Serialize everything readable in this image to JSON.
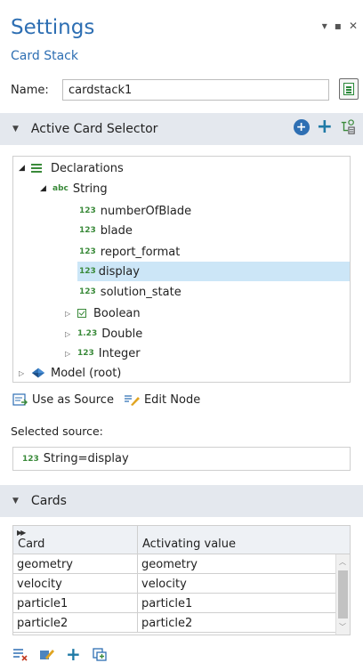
{
  "header": {
    "title": "Settings",
    "subtitle": "Card Stack",
    "window_controls": [
      "▾",
      "▪",
      "✕"
    ]
  },
  "name_field": {
    "label": "Name:",
    "value": "cardstack1"
  },
  "selector_section": {
    "title": "Active Card Selector"
  },
  "tree": {
    "nodes": [
      {
        "label": "Declarations",
        "icon": "list-icon",
        "expanded": true
      },
      {
        "label": "String",
        "icon": "abc-icon",
        "badge": "abc",
        "expanded": true
      },
      {
        "label": "numberOfBlade",
        "badge": "123"
      },
      {
        "label": "blade",
        "badge": "123"
      },
      {
        "label": "report_format",
        "badge": "123"
      },
      {
        "label": "display",
        "badge": "123",
        "selected": true
      },
      {
        "label": "solution_state",
        "badge": "123"
      },
      {
        "label": "Boolean",
        "icon": "checkbox-icon",
        "expanded": false
      },
      {
        "label": "Double",
        "badge": "1.23",
        "expanded": false
      },
      {
        "label": "Integer",
        "badge": "123",
        "expanded": false
      },
      {
        "label": "Model (root)",
        "icon": "model-icon",
        "expanded": false
      }
    ]
  },
  "actions": {
    "use_as_source": "Use as Source",
    "edit_node": "Edit Node"
  },
  "selected_source": {
    "label": "Selected source:",
    "badge": "123",
    "value": "String=display"
  },
  "cards_section": {
    "title": "Cards"
  },
  "cards_table": {
    "columns": [
      "Card",
      "Activating value"
    ],
    "rows": [
      [
        "geometry",
        "geometry"
      ],
      [
        "velocity",
        "velocity"
      ],
      [
        "particle1",
        "particle1"
      ],
      [
        "particle2",
        "particle2"
      ]
    ]
  },
  "colors": {
    "accent": "#2e6fb3",
    "section_bg": "#e4e8ee",
    "selection": "#cce6f7",
    "badge_green": "#3a8a3a"
  }
}
